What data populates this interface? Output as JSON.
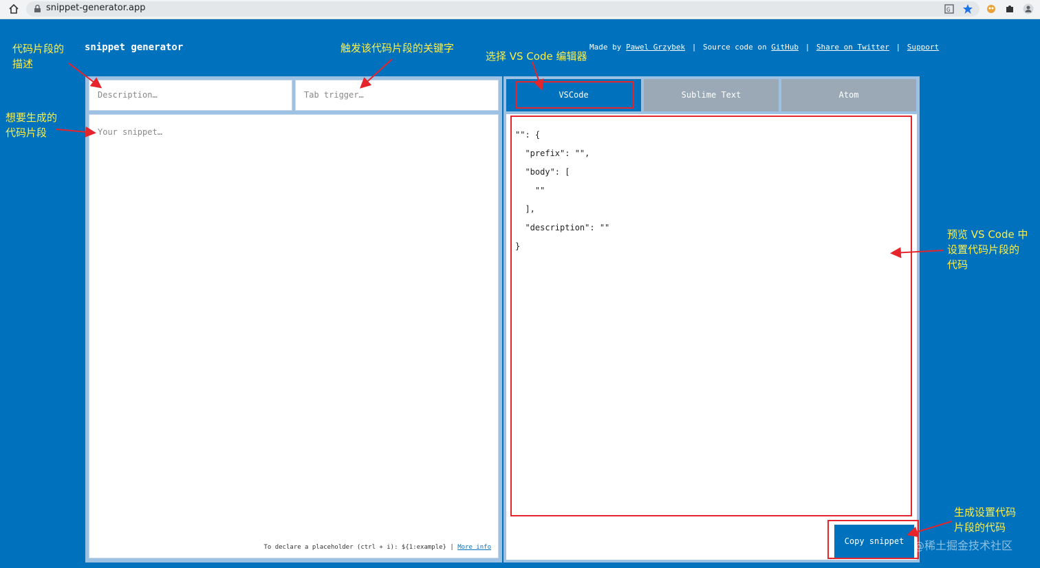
{
  "browser": {
    "url": "snippet-generator.app"
  },
  "header": {
    "title": "snippet generator",
    "made_by_prefix": "Made by",
    "author": "Pawel Grzybek",
    "sep": "|",
    "source_prefix": "Source code on",
    "github": "GitHub",
    "share": "Share on Twitter",
    "support": "Support"
  },
  "form": {
    "description_placeholder": "Description…",
    "trigger_placeholder": "Tab trigger…",
    "snippet_placeholder": "Your snippet…",
    "hint": "To declare a placeholder (ctrl + i): ${1:example} |",
    "more_info": "More info"
  },
  "tabs": [
    {
      "label": "VSCode"
    },
    {
      "label": "Sublime Text"
    },
    {
      "label": "Atom"
    }
  ],
  "preview": {
    "code": "\"\": {\n  \"prefix\": \"\",\n  \"body\": [\n    \"\"\n  ],\n  \"description\": \"\"\n}"
  },
  "copy_button": "Copy snippet",
  "annotations": {
    "description": "代码片段的\n描述",
    "trigger": "触发该代码片段的关键字",
    "editor": "选择 VS Code 编辑器",
    "snippet": "想要生成的\n代码片段",
    "preview": "预览 VS Code 中\n设置代码片段的\n代码",
    "copy": "生成设置代码\n片段的代码"
  },
  "watermark": "@稀土掘金技术社区",
  "colors": {
    "background": "#0071bc",
    "panel": "#9dc1e3",
    "tab_inactive": "#9aa9b5",
    "annotation": "#ffef4a",
    "highlight": "#e5242b"
  }
}
